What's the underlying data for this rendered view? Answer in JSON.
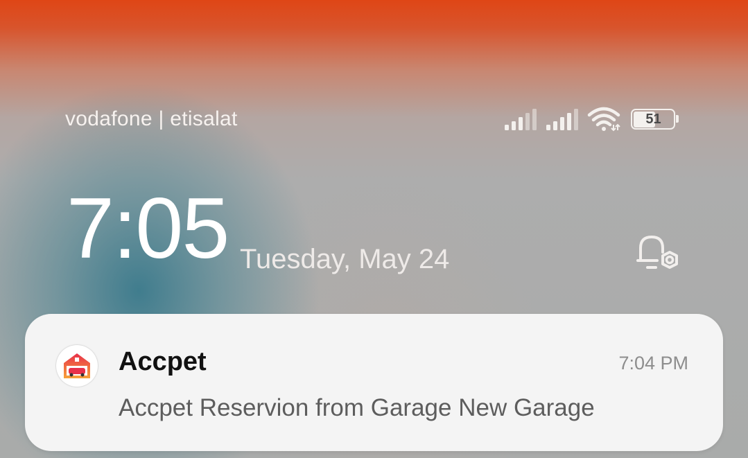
{
  "status_bar": {
    "carrier": "vodafone | etisalat",
    "battery_level": "51",
    "icons": [
      "signal-sim1-icon",
      "signal-sim2-icon",
      "wifi-icon",
      "battery-icon"
    ]
  },
  "lock_screen": {
    "time": "7:05",
    "date": "Tuesday, May 24",
    "notification_settings_icon": "bell-gear-icon"
  },
  "notification": {
    "app_name": "Accpet",
    "time": "7:04 PM",
    "body": "Accpet Reservion from Garage New Garage",
    "app_icon": "garage-house-icon",
    "colors": {
      "icon_primary": "#e8304a",
      "icon_secondary": "#f7a23a"
    }
  }
}
